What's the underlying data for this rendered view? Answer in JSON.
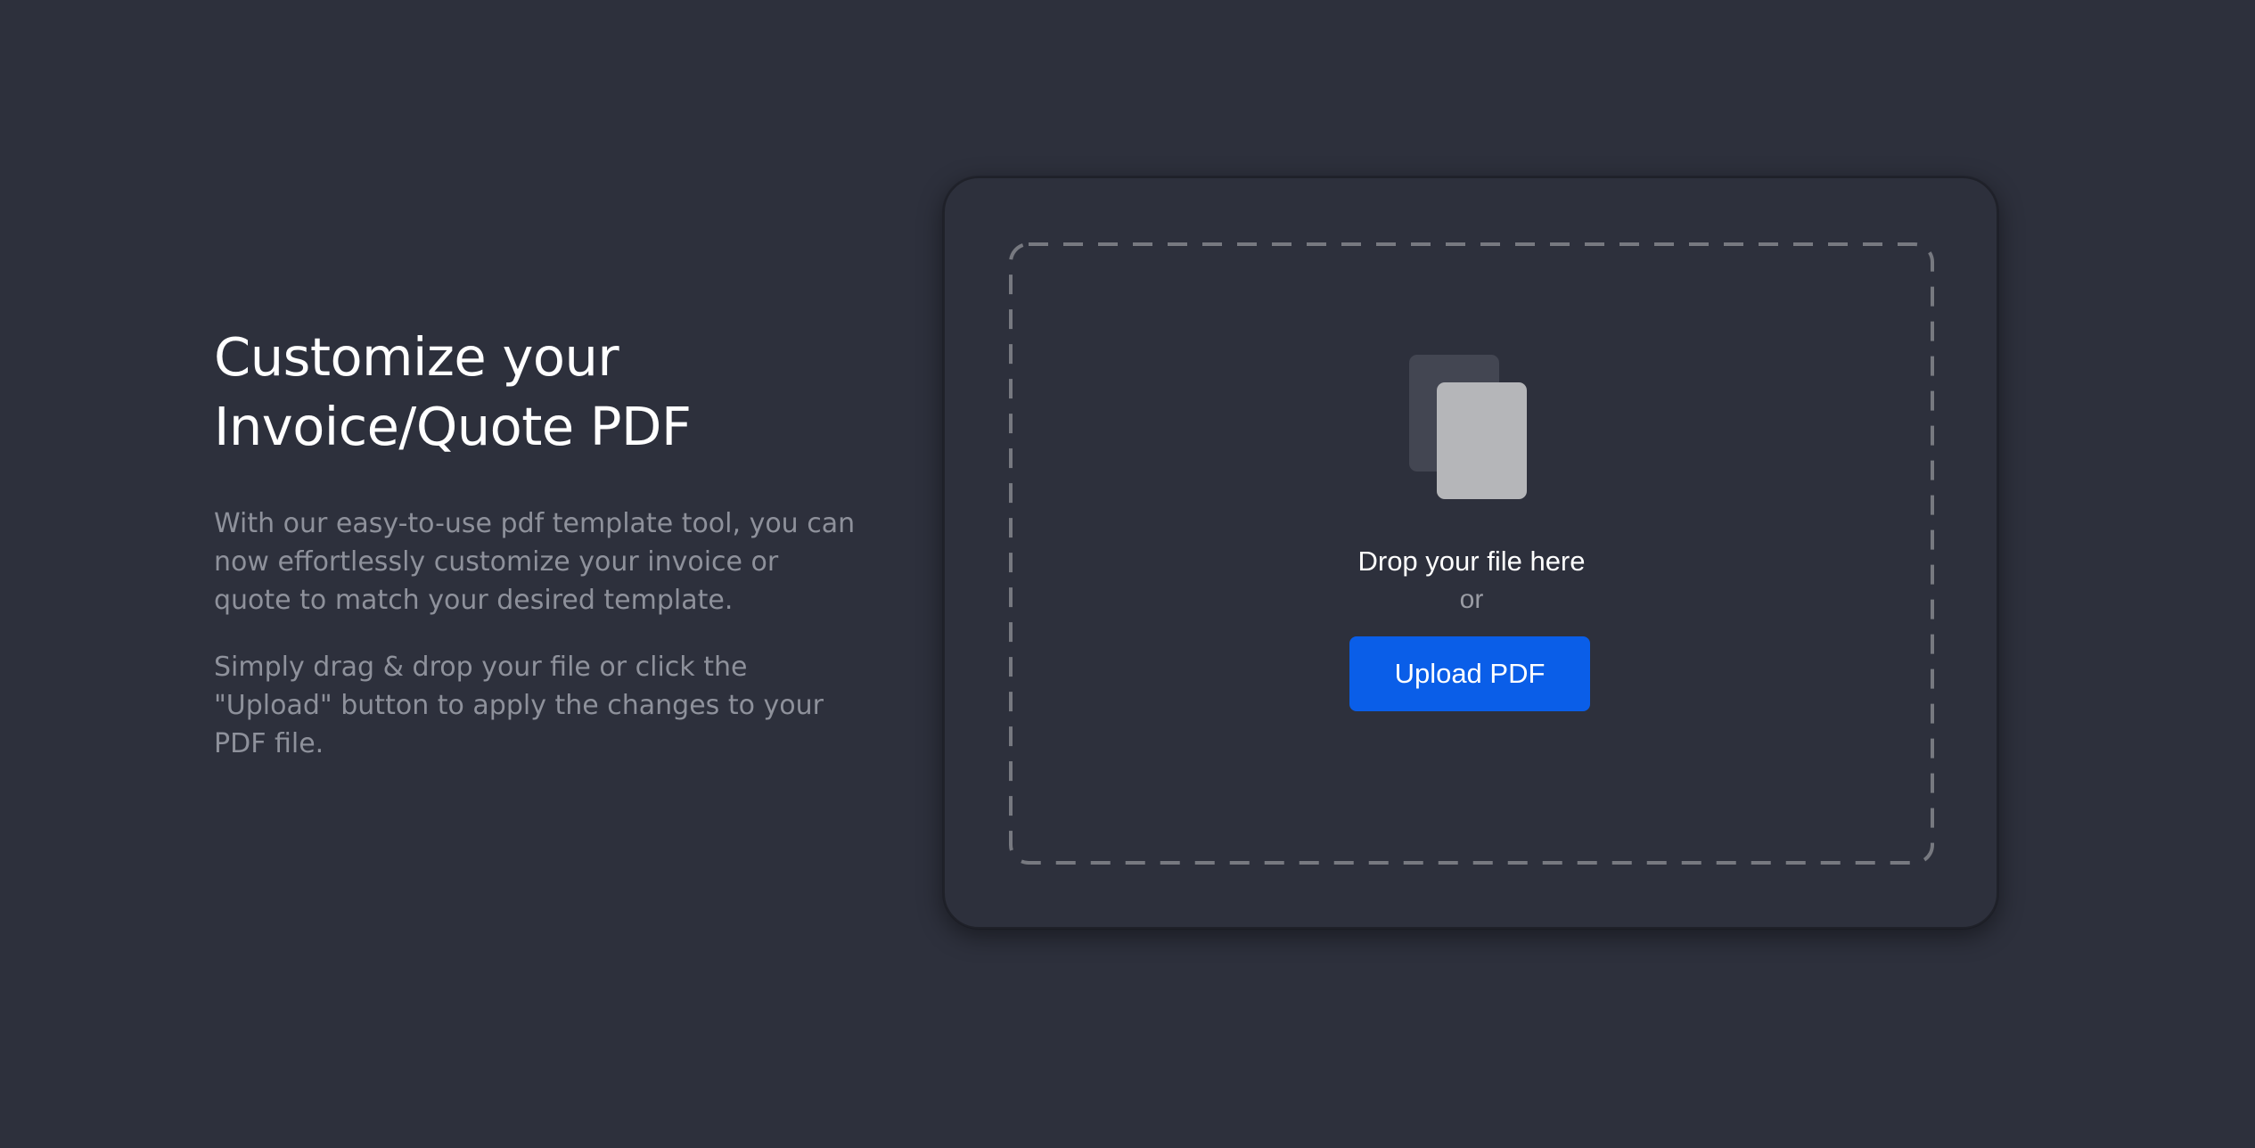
{
  "intro": {
    "title_line1": "Customize your",
    "title_line2": "Invoice/Quote PDF",
    "paragraph1": "With our easy-to-use pdf template tool, you can now effortlessly customize your invoice or quote to match your desired template.",
    "paragraph2": "Simply drag & drop your file or click the \"Upload\" button to apply the changes to your PDF file."
  },
  "dropzone": {
    "icon": "document-stack-icon",
    "drop_label": "Drop your file here",
    "or_label": "or",
    "upload_button_label": "Upload PDF"
  },
  "colors": {
    "background": "#2d303c",
    "accent": "#0a5ee8",
    "muted_text": "#8e919b"
  }
}
